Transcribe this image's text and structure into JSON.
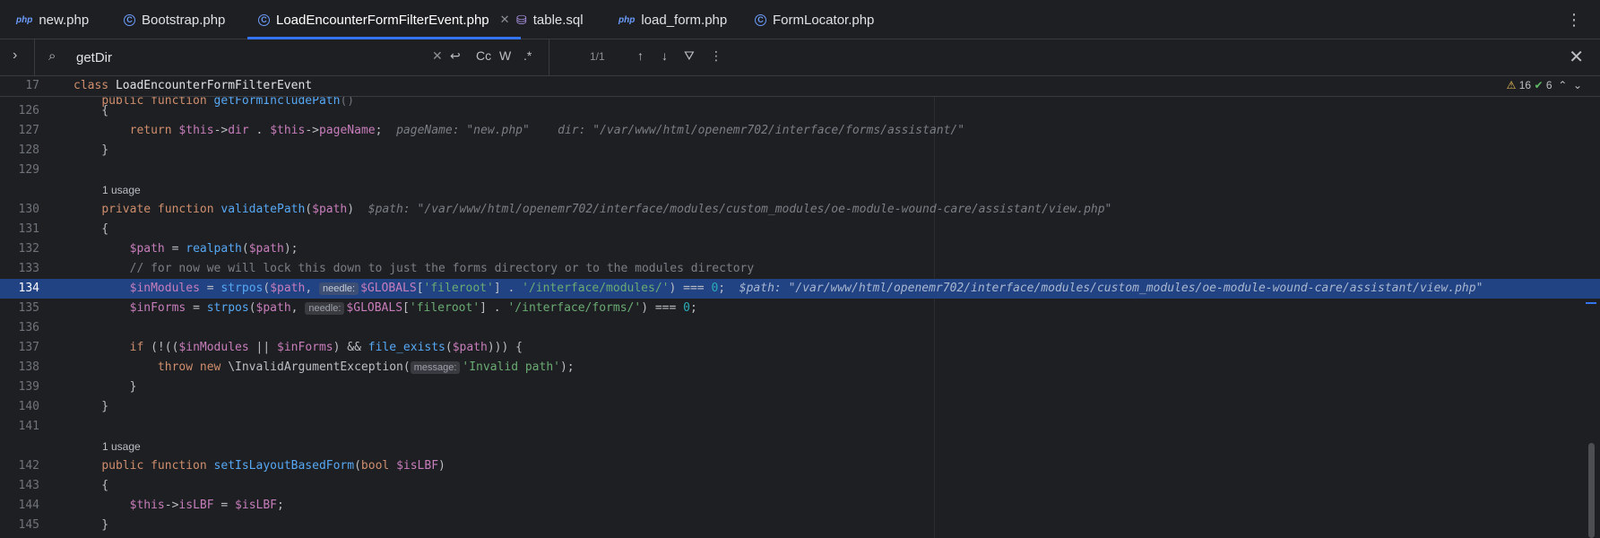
{
  "tabs": [
    {
      "icon": "php",
      "label": "new.php"
    },
    {
      "icon": "class",
      "label": "Bootstrap.php"
    },
    {
      "icon": "class",
      "label": "LoadEncounterFormFilterEvent.php",
      "active": true
    },
    {
      "icon": "db",
      "label": "table.sql"
    },
    {
      "icon": "php",
      "label": "load_form.php"
    },
    {
      "icon": "class",
      "label": "FormLocator.php"
    }
  ],
  "find": {
    "query": "getDir",
    "match_case": "Cc",
    "words": "W",
    "regex": ".*",
    "count": "1/1"
  },
  "sticky": {
    "line": "17",
    "keyword": "class",
    "name": "LoadEncounterFormFilterEvent"
  },
  "inspections": {
    "warnings": "16",
    "ok": "6"
  },
  "code": {
    "l126": "126",
    "l127": "127",
    "l128": "128",
    "l129": "129",
    "l130": "130",
    "l131": "131",
    "l132": "132",
    "l133": "133",
    "l134": "134",
    "l135": "135",
    "l136": "136",
    "l137": "137",
    "l138": "138",
    "l139": "139",
    "l140": "140",
    "l141": "141",
    "l142": "142",
    "l143": "143",
    "l144": "144",
    "l145": "145",
    "usage1": "1 usage",
    "usage2": "1 usage",
    "hint127_page": "pageName: \"new.php\"",
    "hint127_dir": "dir: \"/var/www/html/openemr702/interface/forms/assistant/\"",
    "hint130": "$path: \"/var/www/html/openemr702/interface/modules/custom_modules/oe-module-wound-care/assistant/view.php\"",
    "comment133": "// for now we will lock this down to just the forms directory or to the modules directory",
    "hint134": "$path: \"/var/www/html/openemr702/interface/modules/custom_modules/oe-module-wound-care/assistant/view.php\"",
    "needle": "needle:",
    "message": "message:",
    "str_fileroot": "'fileroot'",
    "str_modules": "'/interface/modules/'",
    "str_forms": "'/interface/forms/'",
    "str_invalid": "'Invalid path'"
  }
}
